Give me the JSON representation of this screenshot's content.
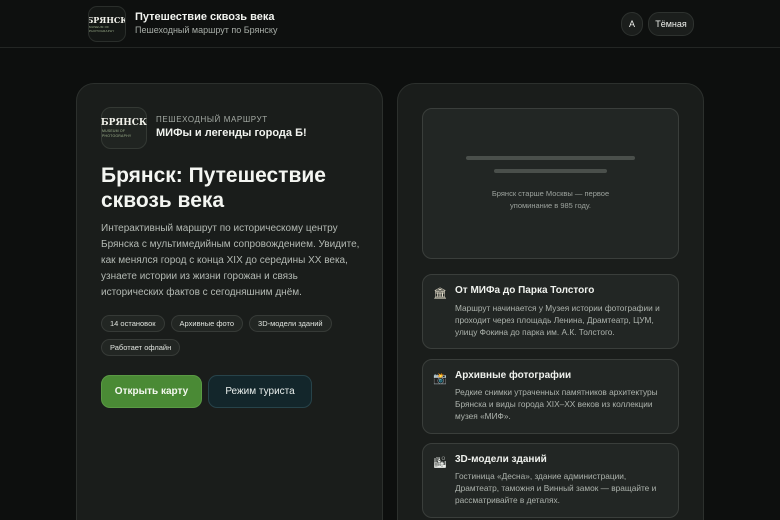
{
  "header": {
    "logo_text": "БРЯНСК",
    "logo_sub": "MUSEUM OF PHOTOGRAPHY",
    "title": "Путешествие сквозь века",
    "subtitle": "Пешеходный маршрут по Брянску",
    "font_button": "A",
    "theme_button": "Тёмная"
  },
  "hero": {
    "logo_text": "БРЯНСК",
    "logo_sub": "MUSEUM OF PHOTOGRAPHY",
    "kicker": "Пешеходный маршрут",
    "route_name": "МИФы и легенды города Б!",
    "title": "Брянск: Путешествие сквозь века",
    "description": "Интерактивный маршрут по историческому центру Брянска с мультимедийным сопровождением. Увидите, как менялся город с конца XIX до середины XX века, узнаете истории из жизни горожан и связь исторических фактов с сегодняшним днём.",
    "tags": [
      "14 остановок",
      "Архивные фото",
      "3D-модели зданий",
      "Работает офлайн"
    ],
    "primary_button": "Открыть карту",
    "secondary_button": "Режим туриста"
  },
  "preview": {
    "caption": "Брянск старше Москвы — первое упоминание в 985 году."
  },
  "features": [
    {
      "icon": "museum-icon",
      "glyph": "🏛",
      "title": "От МИФа до Парка Толстого",
      "text": "Маршрут начинается у Музея истории фотографии и проходит через площадь Ленина, Драмтеатр, ЦУМ, улицу Фокина до парка им. А.К. Толстого."
    },
    {
      "icon": "camera-icon",
      "glyph": "📸",
      "title": "Архивные фотографии",
      "text": "Редкие снимки утраченных памятников архитектуры Брянска и виды города XIX–XX веков из коллекции музея «МИФ»."
    },
    {
      "icon": "building-3d-icon",
      "glyph": "🏙",
      "title": "3D-модели зданий",
      "text": "Гостиница «Десна», здание администрации, Драмтеатр, таможня и Винный замок — вращайте и рассматривайте в деталях."
    }
  ]
}
